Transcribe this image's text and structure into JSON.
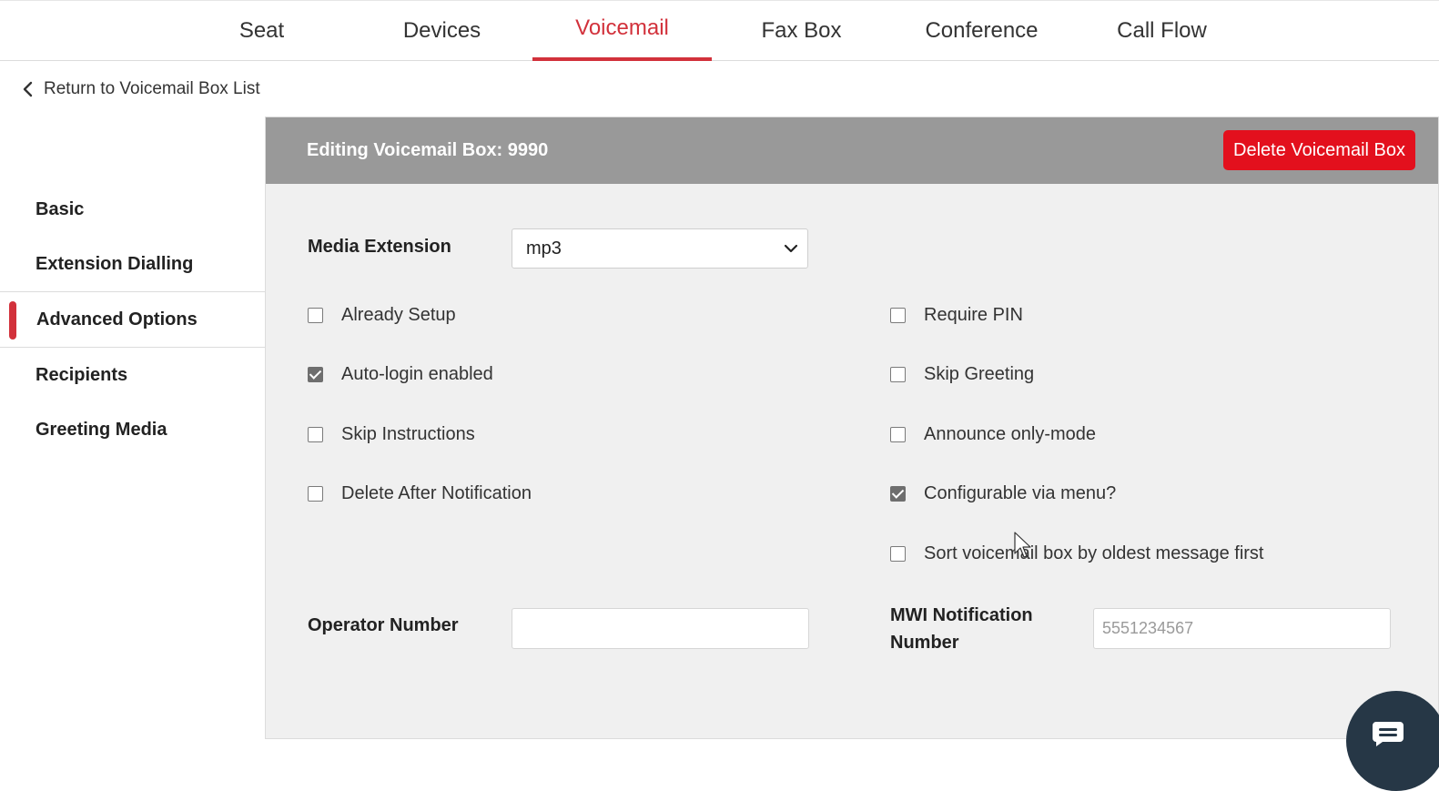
{
  "tabs": [
    {
      "label": "Seat",
      "active": false
    },
    {
      "label": "Devices",
      "active": false
    },
    {
      "label": "Voicemail",
      "active": true
    },
    {
      "label": "Fax Box",
      "active": false
    },
    {
      "label": "Conference",
      "active": false
    },
    {
      "label": "Call Flow",
      "active": false
    }
  ],
  "back_link": {
    "label": "Return to Voicemail Box List",
    "icon": "chevron-left-icon"
  },
  "sidenav": {
    "items": [
      {
        "label": "Basic",
        "active": false
      },
      {
        "label": "Extension Dialling",
        "active": false
      },
      {
        "label": "Advanced Options",
        "active": true
      },
      {
        "label": "Recipients",
        "active": false
      },
      {
        "label": "Greeting Media",
        "active": false
      }
    ]
  },
  "panel": {
    "title": "Editing Voicemail Box: 9990",
    "delete_label": "Delete Voicemail Box"
  },
  "form": {
    "media_extension": {
      "label": "Media Extension",
      "value": "mp3"
    },
    "checkboxes_left": [
      {
        "label": "Already Setup",
        "checked": false
      },
      {
        "label": "Auto-login enabled",
        "checked": true
      },
      {
        "label": "Skip Instructions",
        "checked": false
      },
      {
        "label": "Delete After Notification",
        "checked": false
      }
    ],
    "checkboxes_right": [
      {
        "label": "Require PIN",
        "checked": false
      },
      {
        "label": "Skip Greeting",
        "checked": false
      },
      {
        "label": "Announce only-mode",
        "checked": false
      },
      {
        "label": "Configurable via menu?",
        "checked": true
      },
      {
        "label": "Sort voicemail box by oldest message first",
        "checked": false
      }
    ],
    "operator_number": {
      "label": "Operator Number",
      "value": "",
      "placeholder": ""
    },
    "mwi_number": {
      "label_line1": "MWI Notification",
      "label_line2": "Number",
      "value": "",
      "placeholder": "5551234567"
    }
  },
  "colors": {
    "accent": "#d2313b",
    "danger": "#e3101d",
    "header_gray": "#999999",
    "panel_bg": "#f0f0f0",
    "chat": "#263746"
  },
  "chat_widget": {
    "icon": "chat-icon"
  }
}
